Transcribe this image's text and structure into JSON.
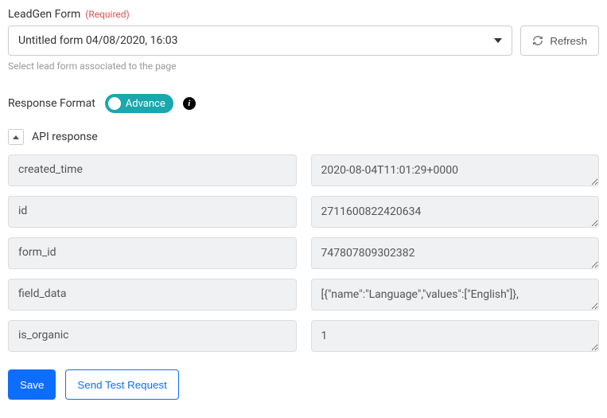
{
  "leadgen": {
    "label": "LeadGen Form",
    "required_tag": "(Required)",
    "selected": "Untitled form 04/08/2020, 16:03",
    "help": "Select lead form associated to the page",
    "refresh_label": "Refresh"
  },
  "response_format": {
    "label": "Response Format",
    "toggle_label": "Advance"
  },
  "accordion": {
    "title": "API response",
    "rows": [
      {
        "key": "created_time",
        "value": "2020-08-04T11:01:29+0000"
      },
      {
        "key": "id",
        "value": "2711600822420634"
      },
      {
        "key": "form_id",
        "value": "747807809302382"
      },
      {
        "key": "field_data",
        "value": "[{\"name\":\"Language\",\"values\":[\"English\"]},"
      },
      {
        "key": "is_organic",
        "value": "1"
      }
    ]
  },
  "actions": {
    "save": "Save",
    "send_test": "Send Test Request"
  }
}
